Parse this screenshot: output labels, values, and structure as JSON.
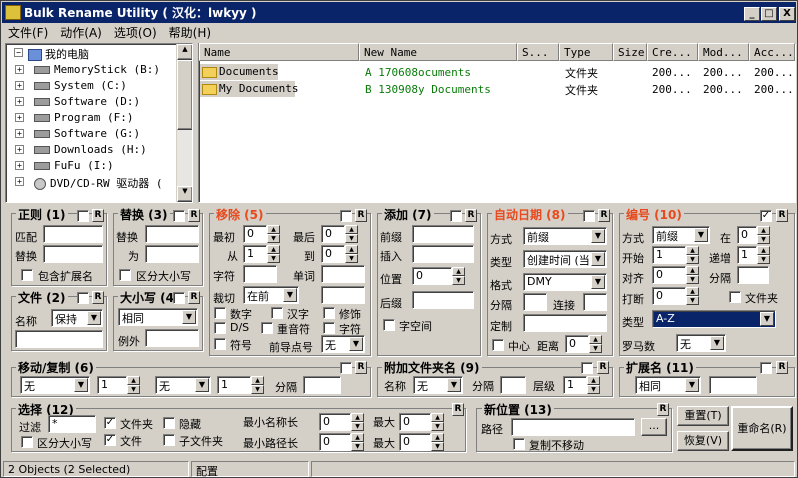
{
  "window": {
    "title": "Bulk Rename Utility ( 汉化：lwkyy )",
    "min": "_",
    "max": "□",
    "close": "X"
  },
  "menu": [
    "文件(F)",
    "动作(A)",
    "选项(O)",
    "帮助(H)"
  ],
  "tree": {
    "root": "我的电脑",
    "drives": [
      "MemoryStick (B:)",
      "System (C:)",
      "Software (D:)",
      "Program (F:)",
      "Software (G:)",
      "Downloads (H:)",
      "FuFu (I:)",
      "DVD/CD-RW 驱动器 ("
    ]
  },
  "files": {
    "columns": [
      "Name",
      "New Name",
      "S...",
      "Type",
      "Size",
      "Cre...",
      "Mod...",
      "Acc..."
    ],
    "rows": [
      {
        "name": "Documents",
        "new": "A 170608ocuments",
        "type": "文件夹",
        "c": "200...",
        "m": "200...",
        "a": "200..."
      },
      {
        "name": "My Documents",
        "new": "B 130908y Documents",
        "type": "文件夹",
        "c": "200...",
        "m": "200...",
        "a": "200..."
      }
    ]
  },
  "regex": {
    "title": "正则 (1)",
    "match": "匹配",
    "replace": "替换",
    "ext": "包含扩展名"
  },
  "repl": {
    "title": "替换 (3)",
    "replace": "替换",
    "with": "为",
    "case": "区分大小写"
  },
  "remove": {
    "title": "移除 (5)",
    "first": "最初",
    "last": "最后",
    "from": "从",
    "to": "到",
    "chars": "字符",
    "words": "单词",
    "crop": "裁切",
    "crop_val": "在前",
    "digits": "数字",
    "han": "汉字",
    "trim": "修饰",
    "ds": "D/S",
    "accent": "重音符",
    "chars2": "字符",
    "sym": "符号",
    "lead": "前导点号",
    "lead_val": "无",
    "v_first": "0",
    "v_last": "0",
    "v_from": "1",
    "v_to": "0"
  },
  "add": {
    "title": "添加 (7)",
    "prefix": "前缀",
    "insert": "插入",
    "pos": "位置",
    "pos_val": "0",
    "suffix": "后缀",
    "space": "字空间"
  },
  "autodate": {
    "title": "自动日期 (8)",
    "mode": "方式",
    "mode_val": "前缀",
    "type": "类型",
    "type_val": "创建时间 (当",
    "fmt": "格式",
    "fmt_val": "DMY",
    "sep": "分隔",
    "conn": "连接",
    "custom": "定制",
    "center": "中心",
    "off": "距离",
    "off_val": "0"
  },
  "number": {
    "title": "编号 (10)",
    "mode": "方式",
    "mode_val": "前缀",
    "at": "在",
    "at_val": "0",
    "start": "开始",
    "start_val": "1",
    "inc": "递增",
    "inc_val": "1",
    "pad": "对齐",
    "pad_val": "0",
    "sep": "分隔",
    "brk": "打断",
    "brk_val": "0",
    "folder": "文件夹",
    "type": "类型",
    "type_val": "A-Z",
    "roman": "罗马数",
    "roman_val": "无"
  },
  "file": {
    "title": "文件 (2)",
    "name": "名称",
    "name_val": "保持"
  },
  "case": {
    "title": "大小写 (4)",
    "val": "相同",
    "except": "例外"
  },
  "move": {
    "title": "移动/复制 (6)",
    "a": "无",
    "b": "1",
    "c": "无",
    "d": "1",
    "sep": "分隔"
  },
  "append": {
    "title": "附加文件夹名 (9)",
    "name": "名称",
    "name_val": "无",
    "sep": "分隔",
    "level": "层级",
    "level_val": "1"
  },
  "ext": {
    "title": "扩展名 (11)",
    "val": "相同"
  },
  "select": {
    "title": "选择 (12)",
    "filter": "过滤",
    "filter_val": "*",
    "folders": "文件夹",
    "hidden": "隐藏",
    "case": "区分大小写",
    "files": "文件",
    "sub": "子文件夹",
    "minname": "最小名称长",
    "minpath": "最小路径长",
    "max": "最大",
    "z": "0"
  },
  "newloc": {
    "title": "新位置 (13)",
    "path": "路径",
    "browse": "...",
    "copy": "复制不移动"
  },
  "actions": {
    "reset": "重置(T)",
    "revert": "恢复(V)",
    "rename": "重命名(R)"
  },
  "status": {
    "left": "2 Objects (2 Selected)",
    "right": "配置"
  },
  "r": "R"
}
